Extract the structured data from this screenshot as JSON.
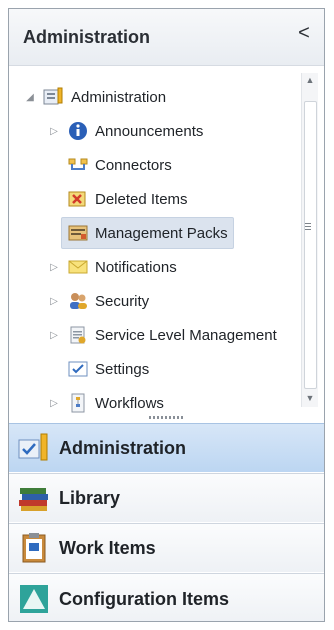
{
  "header": {
    "title": "Administration",
    "collapse_glyph": "<"
  },
  "tree": {
    "root": {
      "label": "Administration",
      "icon": "admin-folder-icon"
    },
    "items": [
      {
        "label": "Announcements",
        "icon": "info-icon",
        "expandable": true
      },
      {
        "label": "Connectors",
        "icon": "connector-icon",
        "expandable": false
      },
      {
        "label": "Deleted Items",
        "icon": "deleted-items-icon",
        "expandable": false
      },
      {
        "label": "Management Packs",
        "icon": "management-packs-icon",
        "expandable": false,
        "selected": true
      },
      {
        "label": "Notifications",
        "icon": "envelope-icon",
        "expandable": true
      },
      {
        "label": "Security",
        "icon": "users-icon",
        "expandable": true
      },
      {
        "label": "Service Level Management",
        "icon": "service-level-icon",
        "expandable": true
      },
      {
        "label": "Settings",
        "icon": "settings-check-icon",
        "expandable": false
      },
      {
        "label": "Workflows",
        "icon": "workflow-icon",
        "expandable": true
      }
    ]
  },
  "workspaces": [
    {
      "label": "Administration",
      "icon": "administration-icon",
      "active": true
    },
    {
      "label": "Library",
      "icon": "books-icon",
      "active": false
    },
    {
      "label": "Work Items",
      "icon": "clipboard-icon",
      "active": false
    },
    {
      "label": "Configuration Items",
      "icon": "pyramid-icon",
      "active": false
    }
  ]
}
